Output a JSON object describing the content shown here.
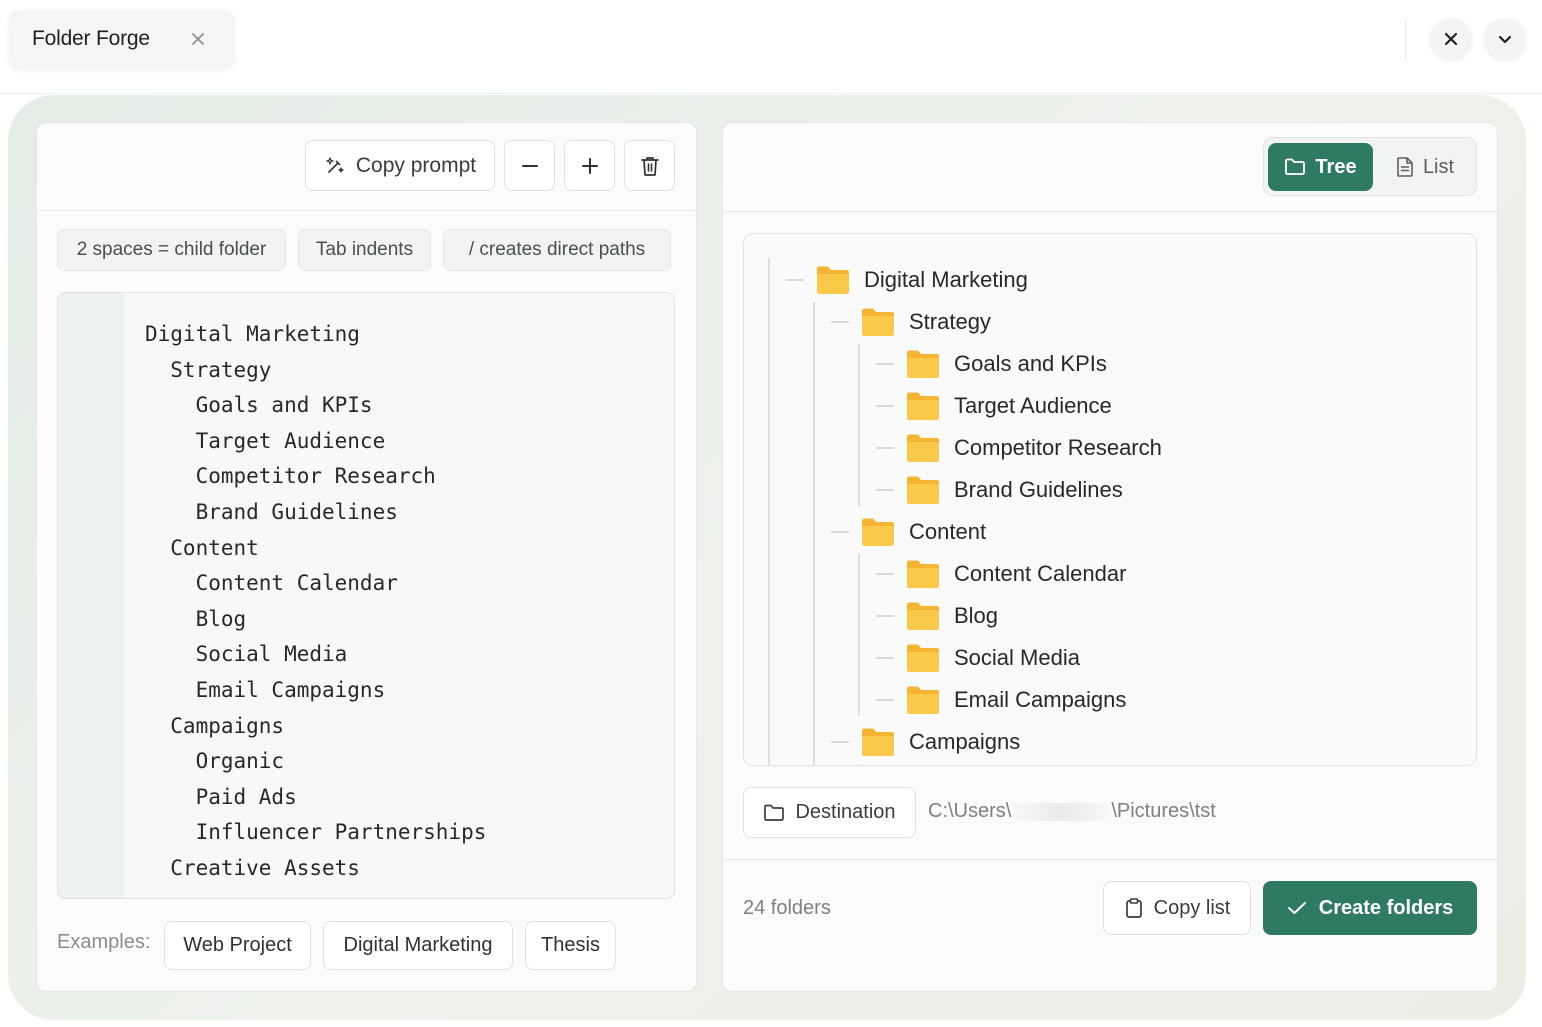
{
  "titlebar": {
    "tab_title": "Folder Forge",
    "tab_close_icon": "close-icon",
    "window_close_icon": "close-icon",
    "window_menu_icon": "chevron-down-icon"
  },
  "editor_panel": {
    "toolbar": {
      "copy_prompt_label": "Copy prompt",
      "copy_prompt_icon": "sparkles-icon",
      "collapse_icon": "minus-icon",
      "expand_icon": "plus-icon",
      "clear_icon": "trash-icon"
    },
    "hints": [
      "2 spaces = child folder",
      "Tab indents",
      "/ creates direct paths"
    ],
    "code_lines": [
      "Digital Marketing",
      "  Strategy",
      "    Goals and KPIs",
      "    Target Audience",
      "    Competitor Research",
      "    Brand Guidelines",
      "  Content",
      "    Content Calendar",
      "    Blog",
      "    Social Media",
      "    Email Campaigns",
      "  Campaigns",
      "    Organic",
      "    Paid Ads",
      "    Influencer Partnerships",
      "  Creative Assets"
    ],
    "examples_label": "Examples:",
    "examples": [
      "Web Project",
      "Digital Marketing",
      "Thesis"
    ]
  },
  "preview_panel": {
    "view_toggle": {
      "tree_label": "Tree",
      "tree_icon": "folder-icon",
      "list_label": "List",
      "list_icon": "document-icon",
      "active": "Tree"
    },
    "tree": [
      {
        "label": "Digital Marketing",
        "depth": 0
      },
      {
        "label": "Strategy",
        "depth": 1
      },
      {
        "label": "Goals and KPIs",
        "depth": 2
      },
      {
        "label": "Target Audience",
        "depth": 2
      },
      {
        "label": "Competitor Research",
        "depth": 2
      },
      {
        "label": "Brand Guidelines",
        "depth": 2
      },
      {
        "label": "Content",
        "depth": 1
      },
      {
        "label": "Content Calendar",
        "depth": 2
      },
      {
        "label": "Blog",
        "depth": 2
      },
      {
        "label": "Social Media",
        "depth": 2
      },
      {
        "label": "Email Campaigns",
        "depth": 2
      },
      {
        "label": "Campaigns",
        "depth": 1
      }
    ],
    "destination": {
      "label": "Destination",
      "icon": "folder-icon",
      "path_start": "C:\\Users\\",
      "path_end": "\\Pictures\\tst"
    },
    "folder_count": "24 folders",
    "copy_list_label": "Copy list",
    "copy_list_icon": "clipboard-icon",
    "create_label": "Create folders",
    "create_icon": "check-icon"
  },
  "colors": {
    "accent": "#2f7a63",
    "folder": "#fbc94a",
    "folder_tab": "#f5b533"
  }
}
